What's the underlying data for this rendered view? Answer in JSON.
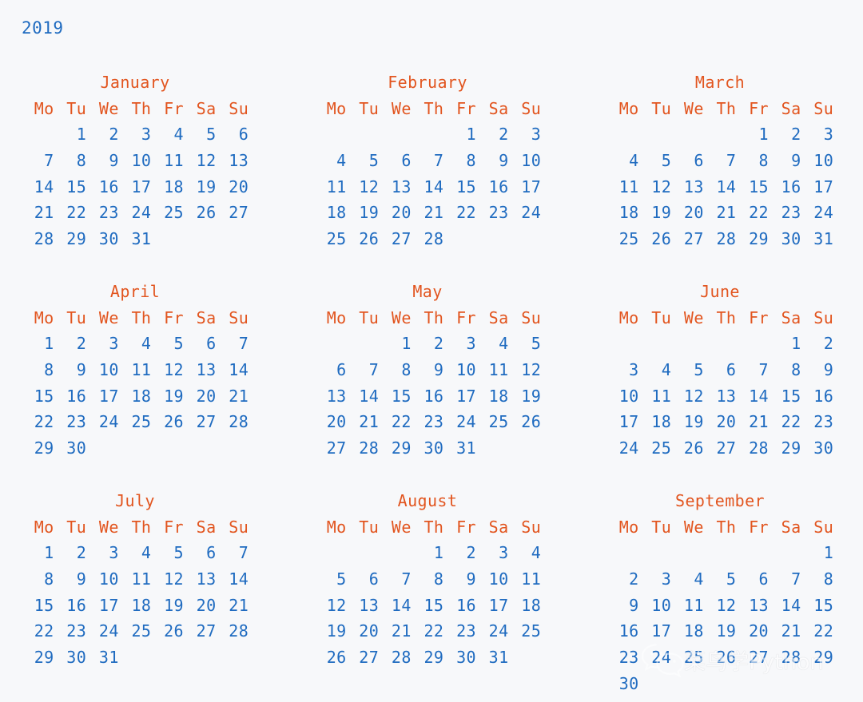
{
  "year": "2019",
  "weekdays": [
    "Mo",
    "Tu",
    "We",
    "Th",
    "Fr",
    "Sa",
    "Su"
  ],
  "watermark": {
    "text": "菜鸟学Python",
    "logo": "wechat-icon"
  },
  "colors": {
    "background": "#f7f8fa",
    "day_number": "#1f6bc0",
    "month_title": "#e2551f",
    "weekday_header": "#e2551f",
    "year_label": "#1f6bc0"
  },
  "months": [
    {
      "name": "January",
      "weeks": [
        [
          "",
          "1",
          "2",
          "3",
          "4",
          "5",
          "6"
        ],
        [
          "7",
          "8",
          "9",
          "10",
          "11",
          "12",
          "13"
        ],
        [
          "14",
          "15",
          "16",
          "17",
          "18",
          "19",
          "20"
        ],
        [
          "21",
          "22",
          "23",
          "24",
          "25",
          "26",
          "27"
        ],
        [
          "28",
          "29",
          "30",
          "31",
          "",
          "",
          ""
        ]
      ]
    },
    {
      "name": "February",
      "weeks": [
        [
          "",
          "",
          "",
          "",
          "1",
          "2",
          "3"
        ],
        [
          "4",
          "5",
          "6",
          "7",
          "8",
          "9",
          "10"
        ],
        [
          "11",
          "12",
          "13",
          "14",
          "15",
          "16",
          "17"
        ],
        [
          "18",
          "19",
          "20",
          "21",
          "22",
          "23",
          "24"
        ],
        [
          "25",
          "26",
          "27",
          "28",
          "",
          "",
          ""
        ]
      ]
    },
    {
      "name": "March",
      "weeks": [
        [
          "",
          "",
          "",
          "",
          "1",
          "2",
          "3"
        ],
        [
          "4",
          "5",
          "6",
          "7",
          "8",
          "9",
          "10"
        ],
        [
          "11",
          "12",
          "13",
          "14",
          "15",
          "16",
          "17"
        ],
        [
          "18",
          "19",
          "20",
          "21",
          "22",
          "23",
          "24"
        ],
        [
          "25",
          "26",
          "27",
          "28",
          "29",
          "30",
          "31"
        ]
      ]
    },
    {
      "name": "April",
      "weeks": [
        [
          "1",
          "2",
          "3",
          "4",
          "5",
          "6",
          "7"
        ],
        [
          "8",
          "9",
          "10",
          "11",
          "12",
          "13",
          "14"
        ],
        [
          "15",
          "16",
          "17",
          "18",
          "19",
          "20",
          "21"
        ],
        [
          "22",
          "23",
          "24",
          "25",
          "26",
          "27",
          "28"
        ],
        [
          "29",
          "30",
          "",
          "",
          "",
          "",
          ""
        ]
      ]
    },
    {
      "name": "May",
      "weeks": [
        [
          "",
          "",
          "1",
          "2",
          "3",
          "4",
          "5"
        ],
        [
          "6",
          "7",
          "8",
          "9",
          "10",
          "11",
          "12"
        ],
        [
          "13",
          "14",
          "15",
          "16",
          "17",
          "18",
          "19"
        ],
        [
          "20",
          "21",
          "22",
          "23",
          "24",
          "25",
          "26"
        ],
        [
          "27",
          "28",
          "29",
          "30",
          "31",
          "",
          ""
        ]
      ]
    },
    {
      "name": "June",
      "weeks": [
        [
          "",
          "",
          "",
          "",
          "",
          "1",
          "2"
        ],
        [
          "3",
          "4",
          "5",
          "6",
          "7",
          "8",
          "9"
        ],
        [
          "10",
          "11",
          "12",
          "13",
          "14",
          "15",
          "16"
        ],
        [
          "17",
          "18",
          "19",
          "20",
          "21",
          "22",
          "23"
        ],
        [
          "24",
          "25",
          "26",
          "27",
          "28",
          "29",
          "30"
        ]
      ]
    },
    {
      "name": "July",
      "weeks": [
        [
          "1",
          "2",
          "3",
          "4",
          "5",
          "6",
          "7"
        ],
        [
          "8",
          "9",
          "10",
          "11",
          "12",
          "13",
          "14"
        ],
        [
          "15",
          "16",
          "17",
          "18",
          "19",
          "20",
          "21"
        ],
        [
          "22",
          "23",
          "24",
          "25",
          "26",
          "27",
          "28"
        ],
        [
          "29",
          "30",
          "31",
          "",
          "",
          "",
          ""
        ]
      ]
    },
    {
      "name": "August",
      "weeks": [
        [
          "",
          "",
          "",
          "1",
          "2",
          "3",
          "4"
        ],
        [
          "5",
          "6",
          "7",
          "8",
          "9",
          "10",
          "11"
        ],
        [
          "12",
          "13",
          "14",
          "15",
          "16",
          "17",
          "18"
        ],
        [
          "19",
          "20",
          "21",
          "22",
          "23",
          "24",
          "25"
        ],
        [
          "26",
          "27",
          "28",
          "29",
          "30",
          "31",
          ""
        ]
      ]
    },
    {
      "name": "September",
      "weeks": [
        [
          "",
          "",
          "",
          "",
          "",
          "",
          "1"
        ],
        [
          "2",
          "3",
          "4",
          "5",
          "6",
          "7",
          "8"
        ],
        [
          "9",
          "10",
          "11",
          "12",
          "13",
          "14",
          "15"
        ],
        [
          "16",
          "17",
          "18",
          "19",
          "20",
          "21",
          "22"
        ],
        [
          "23",
          "24",
          "25",
          "26",
          "27",
          "28",
          "29"
        ],
        [
          "30",
          "",
          "",
          "",
          "",
          "",
          ""
        ]
      ]
    }
  ]
}
